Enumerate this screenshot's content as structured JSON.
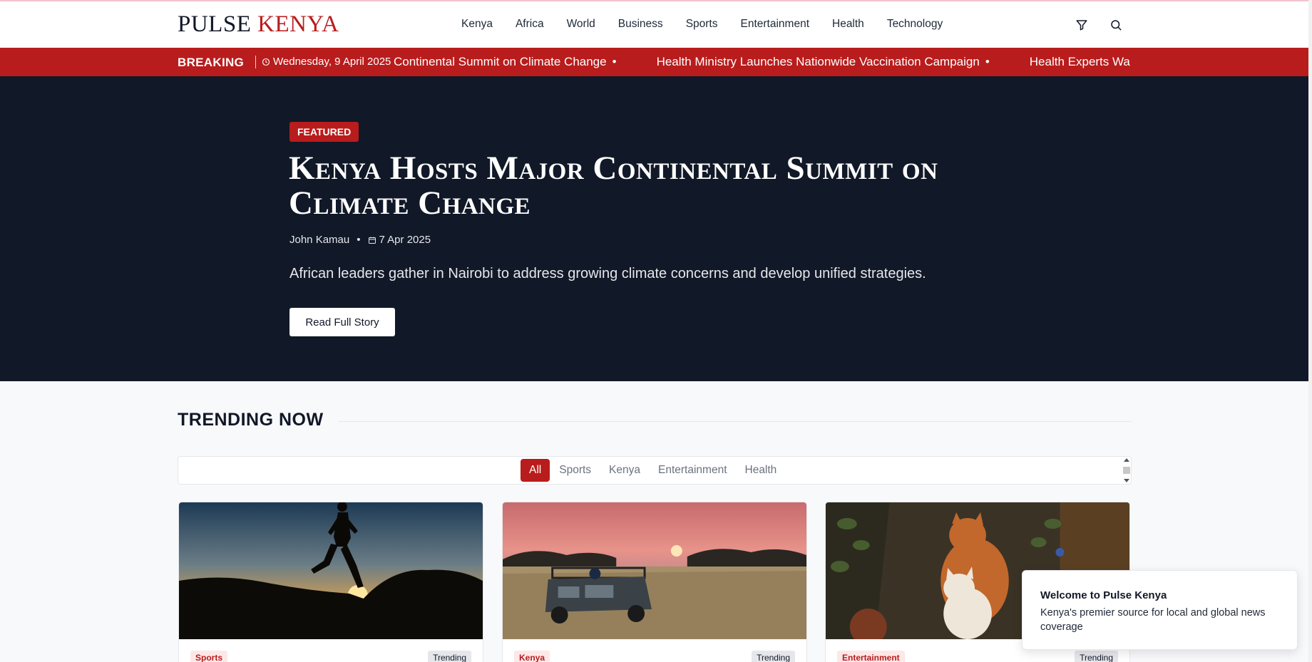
{
  "header": {
    "logo_left": "PULSE",
    "logo_right": "KENYA",
    "nav": [
      "Kenya",
      "Africa",
      "World",
      "Business",
      "Sports",
      "Entertainment",
      "Health",
      "Technology"
    ],
    "icons": [
      "filter-icon",
      "search-icon"
    ]
  },
  "breaking": {
    "label": "BREAKING",
    "date": "Wednesday, 9 April 2025",
    "items": [
      "Continental Summit on Climate Change",
      "Health Ministry Launches Nationwide Vaccination Campaign",
      "Health Experts Wa"
    ]
  },
  "hero": {
    "badge": "FEATURED",
    "title": "Kenya Hosts Major Continental Summit on Climate Change",
    "author": "John Kamau",
    "date": "7 Apr 2025",
    "summary": "African leaders gather in Nairobi to address growing climate concerns and develop unified strategies.",
    "cta": "Read Full Story"
  },
  "trending": {
    "title": "TRENDING NOW",
    "filters": [
      "All",
      "Sports",
      "Kenya",
      "Entertainment",
      "Health"
    ],
    "active_filter": "All",
    "cards": [
      {
        "category": "Sports",
        "tag": "Trending",
        "image": "runner-silhouette-sunset"
      },
      {
        "category": "Kenya",
        "tag": "Trending",
        "image": "safari-vehicle-savanna-sunset"
      },
      {
        "category": "Entertainment",
        "tag": "Trending",
        "image": "cats-painting"
      }
    ]
  },
  "toast": {
    "title": "Welcome to Pulse Kenya",
    "body": "Kenya's premier source for local and global news coverage"
  },
  "colors": {
    "brand_red": "#b91c1c",
    "hero_bg": "#111827",
    "page_bg": "#f8f9fb"
  }
}
